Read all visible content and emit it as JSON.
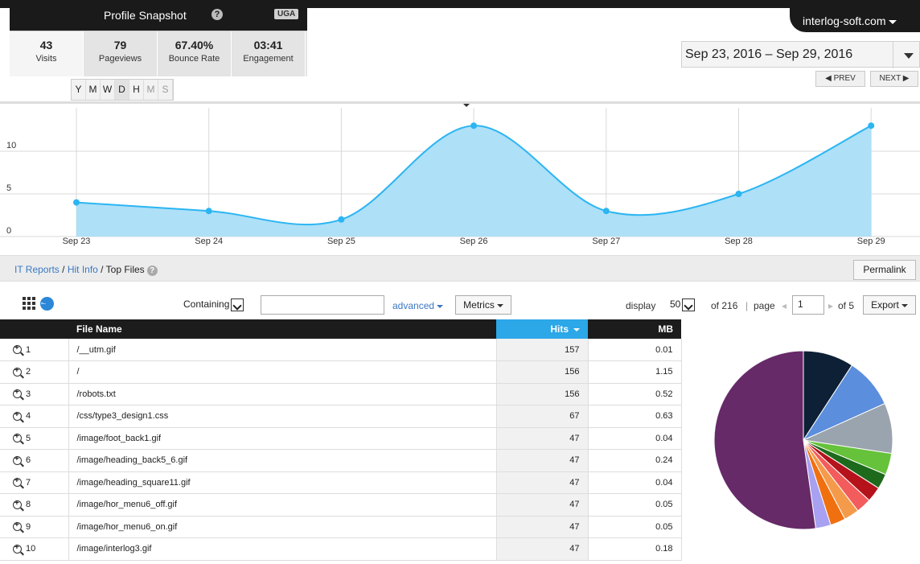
{
  "profile": {
    "title": "Profile Snapshot",
    "help_glyph": "?",
    "badge": "UGA",
    "metrics": [
      {
        "value": "43",
        "label": "Visits"
      },
      {
        "value": "79",
        "label": "Pageviews"
      },
      {
        "value": "67.40%",
        "label": "Bounce Rate"
      },
      {
        "value": "03:41",
        "label": "Engagement"
      }
    ],
    "granularity": [
      "Y",
      "M",
      "W",
      "D",
      "H",
      "M",
      "S"
    ]
  },
  "domain": "interlog-soft.com",
  "date_range": "Sep 23, 2016 – Sep 29, 2016",
  "nav": {
    "prev": "◀ PREV",
    "next": "NEXT ▶"
  },
  "chart_data": {
    "type": "area",
    "categories": [
      "Sep 23",
      "Sep 24",
      "Sep 25",
      "Sep 26",
      "Sep 27",
      "Sep 28",
      "Sep 29"
    ],
    "values": [
      4,
      3,
      2,
      13,
      3,
      5,
      13
    ],
    "ylim": [
      0,
      15
    ],
    "yticks": [
      "10",
      "5",
      "0"
    ],
    "grid": true,
    "color": "#2bb5f2"
  },
  "breadcrumb": {
    "items": [
      "IT Reports",
      "Hit Info"
    ],
    "sep": " / ",
    "current": "Top Files",
    "help_glyph": "?"
  },
  "permalink": "Permalink",
  "toolbar": {
    "filter_mode": "Containing",
    "advanced": "advanced",
    "metrics": "Metrics",
    "display_label": "display",
    "display_value": "50",
    "of_total": "of 216",
    "page_sep": "|",
    "page_label": "page",
    "page_value": "1",
    "of_pages": "of 5",
    "export": "Export"
  },
  "table": {
    "headers": {
      "name": "File Name",
      "hits": "Hits",
      "mb": "MB"
    },
    "rows": [
      {
        "idx": "1",
        "name": "/__utm.gif",
        "hits": "157",
        "mb": "0.01"
      },
      {
        "idx": "2",
        "name": "/",
        "hits": "156",
        "mb": "1.15"
      },
      {
        "idx": "3",
        "name": "/robots.txt",
        "hits": "156",
        "mb": "0.52"
      },
      {
        "idx": "4",
        "name": "/css/type3_design1.css",
        "hits": "67",
        "mb": "0.63"
      },
      {
        "idx": "5",
        "name": "/image/foot_back1.gif",
        "hits": "47",
        "mb": "0.04"
      },
      {
        "idx": "6",
        "name": "/image/heading_back5_6.gif",
        "hits": "47",
        "mb": "0.24"
      },
      {
        "idx": "7",
        "name": "/image/heading_square11.gif",
        "hits": "47",
        "mb": "0.04"
      },
      {
        "idx": "8",
        "name": "/image/hor_menu6_off.gif",
        "hits": "47",
        "mb": "0.05"
      },
      {
        "idx": "9",
        "name": "/image/hor_menu6_on.gif",
        "hits": "47",
        "mb": "0.05"
      },
      {
        "idx": "10",
        "name": "/image/interlog3.gif",
        "hits": "47",
        "mb": "0.18"
      }
    ]
  },
  "pie": {
    "values": [
      157,
      156,
      156,
      67,
      47,
      47,
      47,
      47,
      47,
      47,
      894
    ],
    "colors": [
      "#0d2035",
      "#5b8edc",
      "#9aa4ae",
      "#66c23a",
      "#1d6a1d",
      "#b5121b",
      "#f25c5c",
      "#f49b4b",
      "#f07010",
      "#a8a0f0",
      "#662a68"
    ]
  }
}
